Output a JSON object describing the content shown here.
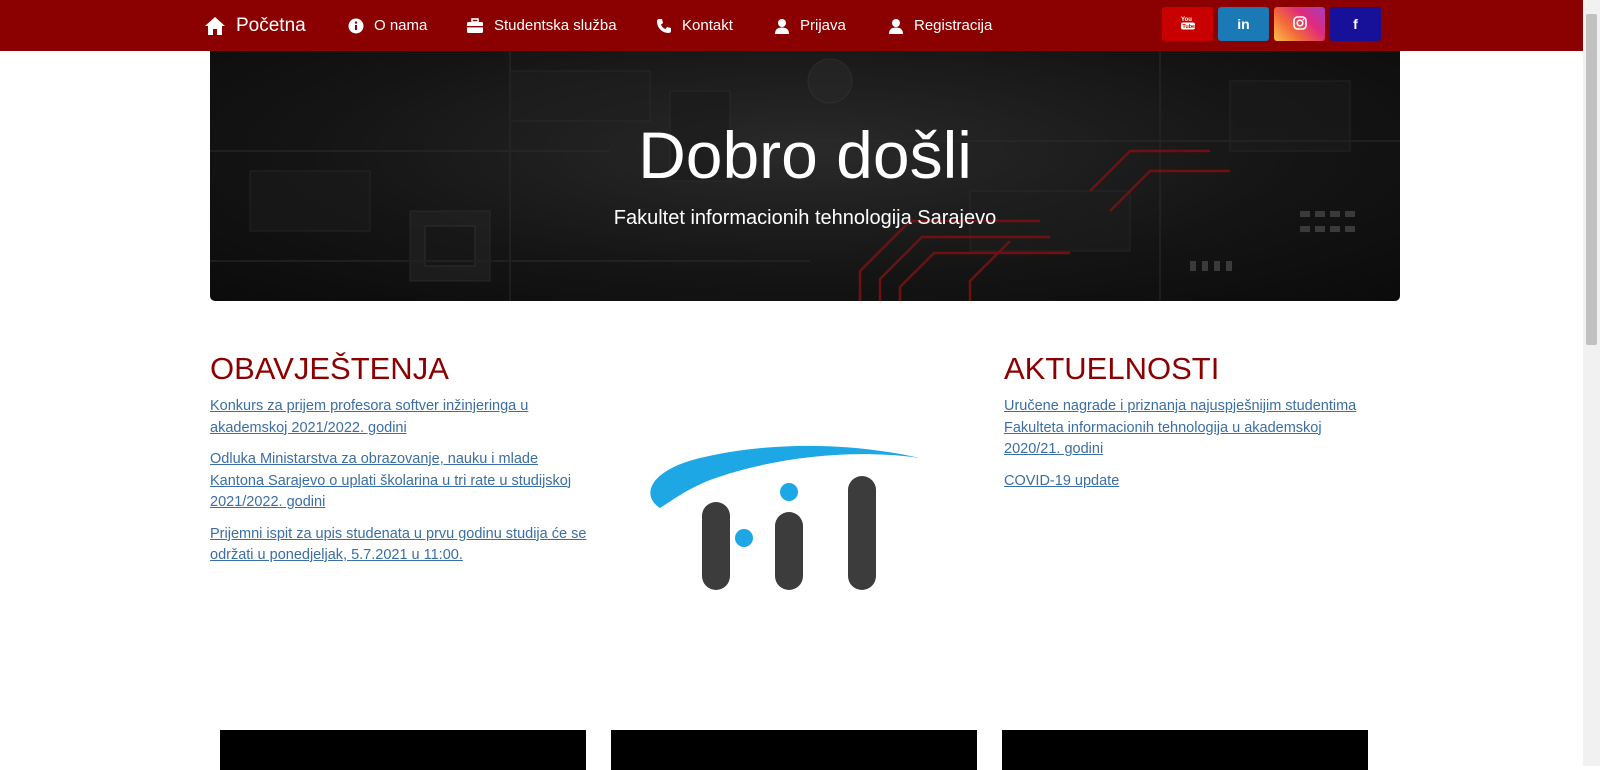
{
  "navbar": {
    "home": "Početna",
    "items": [
      {
        "label": "O nama",
        "icon": "info-icon"
      },
      {
        "label": "Studentska služba",
        "icon": "briefcase-icon"
      },
      {
        "label": "Kontakt",
        "icon": "phone-icon"
      },
      {
        "label": "Prijava",
        "icon": "user-icon"
      },
      {
        "label": "Registracija",
        "icon": "user-icon"
      }
    ],
    "social": [
      {
        "label": "",
        "icon": "youtube-icon",
        "color": "#c4302b"
      },
      {
        "label": "in",
        "icon": "linkedin-icon",
        "color": "#0e76a8"
      },
      {
        "label": "",
        "icon": "instagram-icon",
        "color": "#e1306c"
      },
      {
        "label": "f",
        "icon": "facebook-icon",
        "color": "#1b1bb5"
      }
    ],
    "color": "#8b0000"
  },
  "hero": {
    "title": "Dobro došli",
    "subtitle": "Fakultet informacionih tehnologija Sarajevo"
  },
  "obavjestenja": {
    "heading": "OBAVJEŠTENJA",
    "items": [
      "Konkurs za prijem profesora softver inžinjeringa u akademskoj 2021/2022. godini",
      "Odluka Ministarstva za obrazovanje, nauku i mlade Kantona Sarajevo o uplati školarina u tri rate u studijskoj 2021/2022. godini",
      "Prijemni ispit za upis studenata u prvu godinu studija će se održati u ponedjeljak, 5.7.2021 u 11:00."
    ]
  },
  "aktuelnosti": {
    "heading": "AKTUELNOSTI",
    "items": [
      "Uručene nagrade i priznanja najuspješnijim studentima Fakulteta informacionih tehnologija u akademskoj 2020/21. godini",
      "COVID-19 update"
    ]
  },
  "colors": {
    "heading": "#8b0000",
    "link": "#3a6ea5",
    "logo_blue": "#1da7e5",
    "logo_gray": "#3c3c3c"
  }
}
